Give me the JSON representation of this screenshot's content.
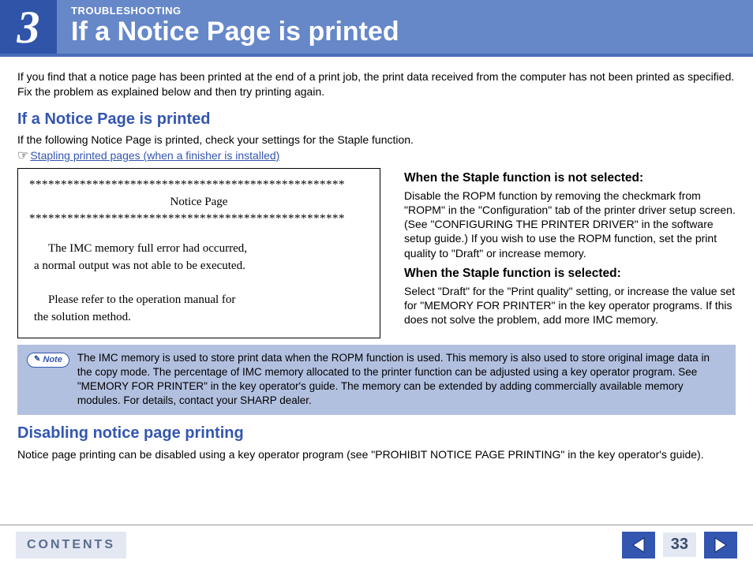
{
  "header": {
    "chapter_number": "3",
    "eyebrow": "TROUBLESHOOTING",
    "title": "If a Notice Page is printed"
  },
  "intro": "If you find that a notice page has been printed at the end of a print job, the print data received from the computer has not been printed as specified. Fix the problem as explained below and then try printing again.",
  "section1": {
    "heading": "If a Notice Page is printed",
    "lead": "If the following Notice Page is printed, check your settings for the Staple function.",
    "pointer": "☞",
    "link_text": "Stapling printed pages (when a finisher is installed)"
  },
  "notice": {
    "stars": "**************************************************",
    "title": "Notice Page",
    "line1": "The IMC memory full error had occurred,",
    "line2": "a normal output was not able to be executed.",
    "line3": "Please refer to the operation manual for",
    "line4": "the solution method."
  },
  "right": {
    "h1": "When the Staple function is not selected:",
    "p1": "Disable the ROPM function by removing the checkmark from \"ROPM\" in the \"Configuration\" tab of the printer driver setup screen. (See \"CONFIGURING THE PRINTER DRIVER\" in the software setup guide.) If you wish to use the ROPM function, set the print quality to \"Draft\" or increase memory.",
    "h2": "When the Staple function is selected:",
    "p2": "Select \"Draft\" for the \"Print quality\" setting, or increase the value set for \"MEMORY FOR PRINTER\" in the key operator programs. If this does not solve the problem, add more IMC memory."
  },
  "note": {
    "badge_icon": "✎",
    "badge_text": "Note",
    "text": "The IMC memory is used to store print data when the ROPM function is used. This memory is also used to store original image data in the copy mode. The percentage of IMC memory allocated to the printer function can be adjusted using a key operator program. See \"MEMORY FOR PRINTER\" in the key operator's guide. The memory can be extended by adding commercially available memory modules. For details, contact your SHARP dealer."
  },
  "section2": {
    "heading": "Disabling notice page printing",
    "text": "Notice page printing can be disabled using a key operator program (see \"PROHIBIT NOTICE PAGE PRINTING\" in the key operator's guide)."
  },
  "footer": {
    "contents_label": "CONTENTS",
    "page_number": "33"
  }
}
